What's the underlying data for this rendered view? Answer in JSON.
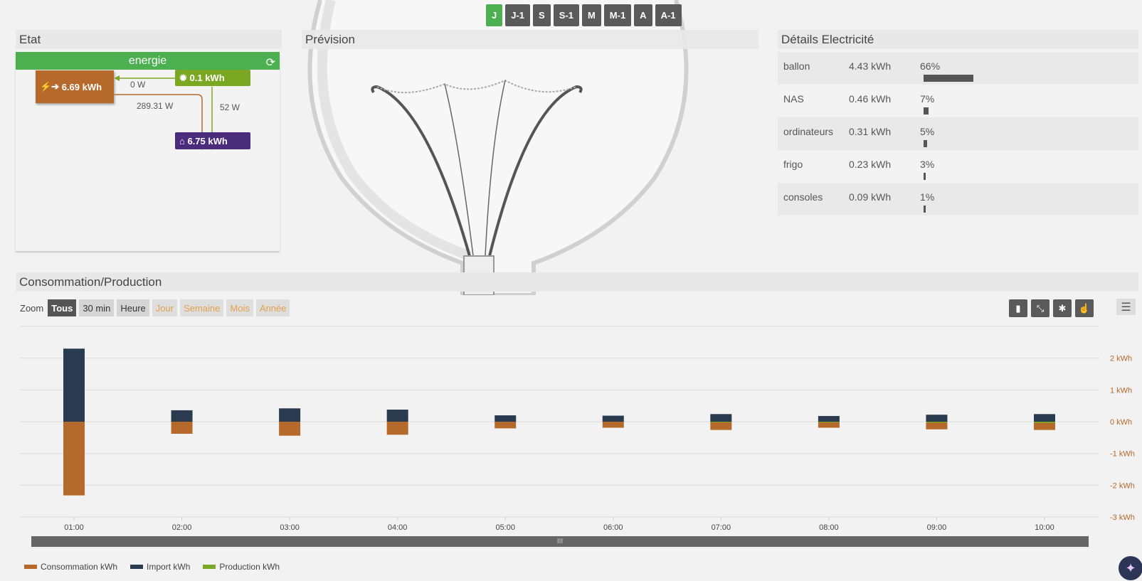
{
  "period_buttons": [
    {
      "label": "J",
      "active": true
    },
    {
      "label": "J-1",
      "active": false
    },
    {
      "label": "S",
      "active": false
    },
    {
      "label": "S-1",
      "active": false
    },
    {
      "label": "M",
      "active": false
    },
    {
      "label": "M-1",
      "active": false
    },
    {
      "label": "A",
      "active": false
    },
    {
      "label": "A-1",
      "active": false
    }
  ],
  "etat": {
    "title": "Etat",
    "header": "energie",
    "grid_node": "6.69 kWh",
    "solar_node": "0.1 kWh",
    "home_node": "6.75 kWh",
    "flow_solar_grid": "0 W",
    "flow_grid_home": "289.31 W",
    "flow_solar_home": "52 W"
  },
  "prevision": {
    "title": "Prévision"
  },
  "details": {
    "title": "Détails Electricité",
    "rows": [
      {
        "name": "ballon",
        "value": "4.43 kWh",
        "pct": "66%",
        "fraction": 0.66
      },
      {
        "name": "NAS",
        "value": "0.46 kWh",
        "pct": "7%",
        "fraction": 0.07
      },
      {
        "name": "ordinateurs",
        "value": "0.31 kWh",
        "pct": "5%",
        "fraction": 0.05
      },
      {
        "name": "frigo",
        "value": "0.23 kWh",
        "pct": "3%",
        "fraction": 0.03
      },
      {
        "name": "consoles",
        "value": "0.09 kWh",
        "pct": "1%",
        "fraction": 0.01
      }
    ]
  },
  "conso": {
    "title": "Consommation/Production",
    "zoom_label": "Zoom",
    "zoom_buttons": [
      {
        "label": "Tous",
        "state": "active"
      },
      {
        "label": "30 min",
        "state": "normal"
      },
      {
        "label": "Heure",
        "state": "normal"
      },
      {
        "label": "Jour",
        "state": "disabled"
      },
      {
        "label": "Semaine",
        "state": "disabled"
      },
      {
        "label": "Mois",
        "state": "disabled"
      },
      {
        "label": "Année",
        "state": "disabled"
      }
    ],
    "scroll_handle": "III"
  },
  "colors": {
    "consommation": "#b5692a",
    "import": "#2a3a4f",
    "production": "#7aa822"
  },
  "chart_data": {
    "type": "bar",
    "categories": [
      "01:00",
      "02:00",
      "03:00",
      "04:00",
      "05:00",
      "06:00",
      "07:00",
      "08:00",
      "09:00",
      "10:00"
    ],
    "series": [
      {
        "name": "Consommation kWh",
        "values": [
          -2.32,
          -0.38,
          -0.44,
          -0.41,
          -0.21,
          -0.19,
          -0.26,
          -0.19,
          -0.24,
          -0.26
        ]
      },
      {
        "name": "Import kWh",
        "values": [
          2.3,
          0.36,
          0.42,
          0.38,
          0.2,
          0.19,
          0.24,
          0.18,
          0.22,
          0.24
        ]
      },
      {
        "name": "Production kWh",
        "values": [
          0,
          0,
          0,
          0,
          0,
          0,
          0.02,
          0.02,
          0.03,
          0.04
        ]
      }
    ],
    "y_ticks": [
      "2 kWh",
      "1 kWh",
      "0 kWh",
      "-1 kWh",
      "-2 kWh",
      "-3 kWh"
    ],
    "ylim": [
      -3,
      3
    ],
    "grid": true,
    "legend": "bottom-left"
  }
}
